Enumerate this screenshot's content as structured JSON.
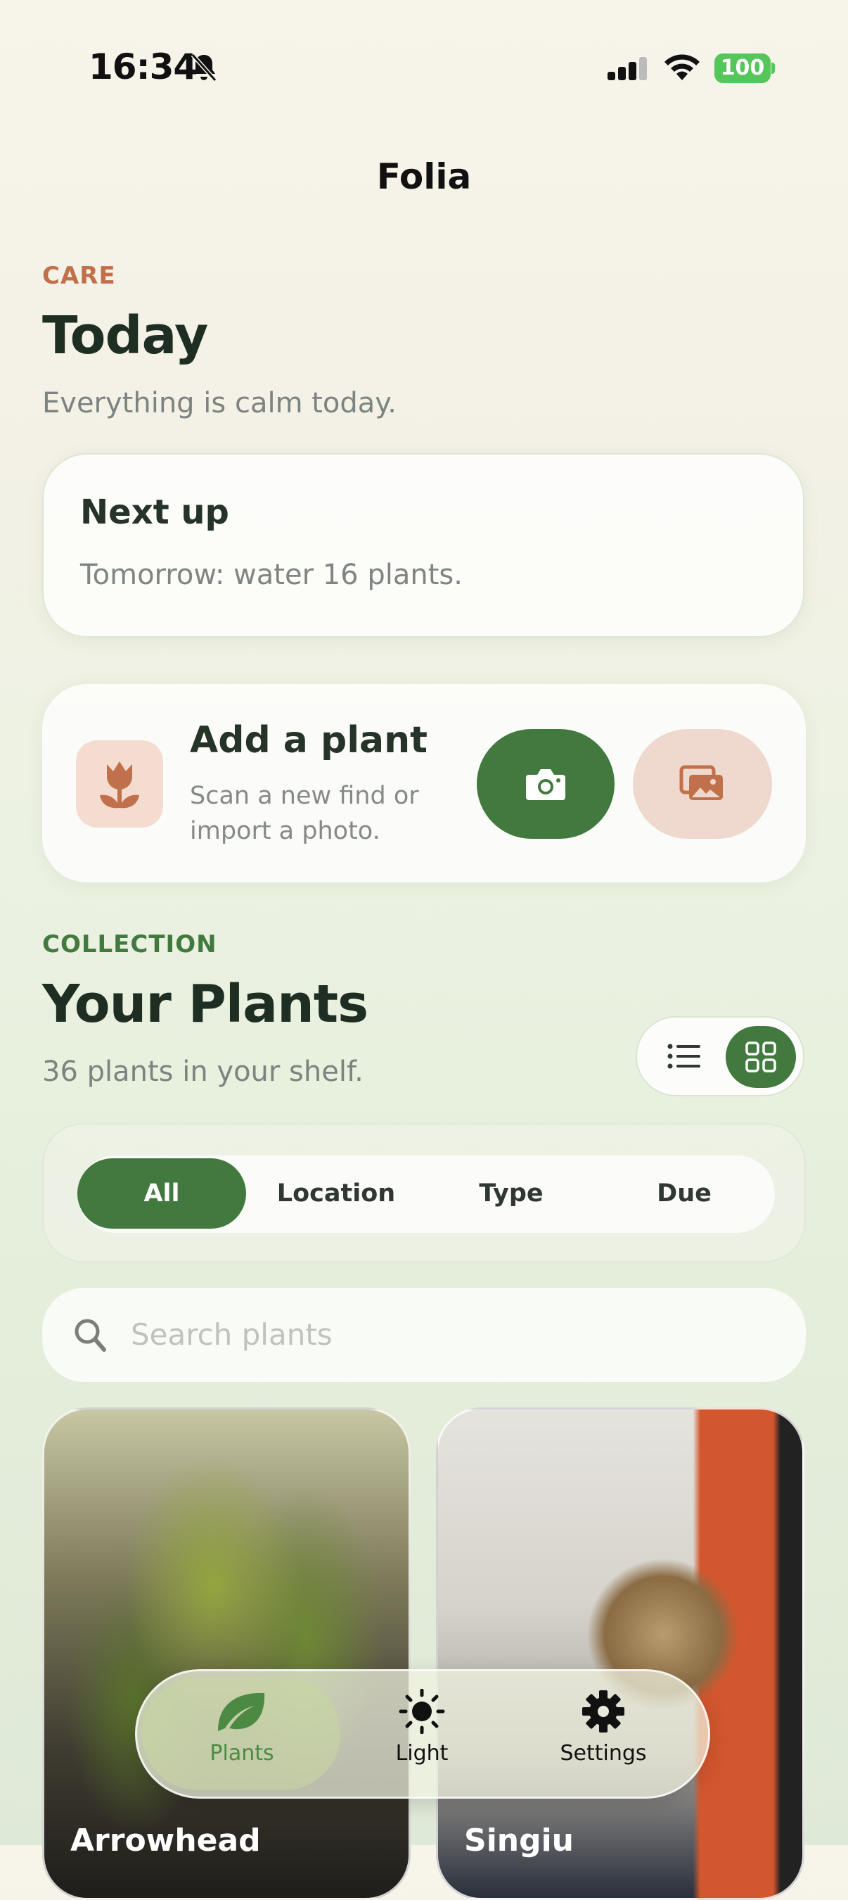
{
  "status_bar": {
    "time": "16:34",
    "battery": "100"
  },
  "app": {
    "title": "Folia"
  },
  "care": {
    "eyebrow": "CARE",
    "title": "Today",
    "subtitle": "Everything is calm today.",
    "next_up": {
      "title": "Next up",
      "text": "Tomorrow: water 16 plants."
    }
  },
  "add_plant": {
    "title": "Add a plant",
    "subtitle": "Scan a new find or import a photo.",
    "icon": "tulip-icon",
    "camera_icon": "camera-icon",
    "photo_icon": "photos-icon"
  },
  "collection": {
    "eyebrow": "COLLECTION",
    "title": "Your Plants",
    "subtitle": "36 plants in your shelf.",
    "view_mode": "grid"
  },
  "filters": {
    "items": [
      "All",
      "Location",
      "Type",
      "Due"
    ],
    "selected": "All"
  },
  "search": {
    "placeholder": "Search plants"
  },
  "plants": [
    {
      "name": "Arrowhead"
    },
    {
      "name": "Singiu"
    }
  ],
  "tabbar": {
    "items": [
      {
        "label": "Plants",
        "icon": "leaf-icon"
      },
      {
        "label": "Light",
        "icon": "sun-icon"
      },
      {
        "label": "Settings",
        "icon": "gear-icon"
      }
    ],
    "selected": "Plants"
  },
  "colors": {
    "accent_green": "#42793f",
    "care_eyebrow": "#c0704a",
    "collection_eyebrow": "#42793f",
    "photo_button": "#efd8cd"
  }
}
